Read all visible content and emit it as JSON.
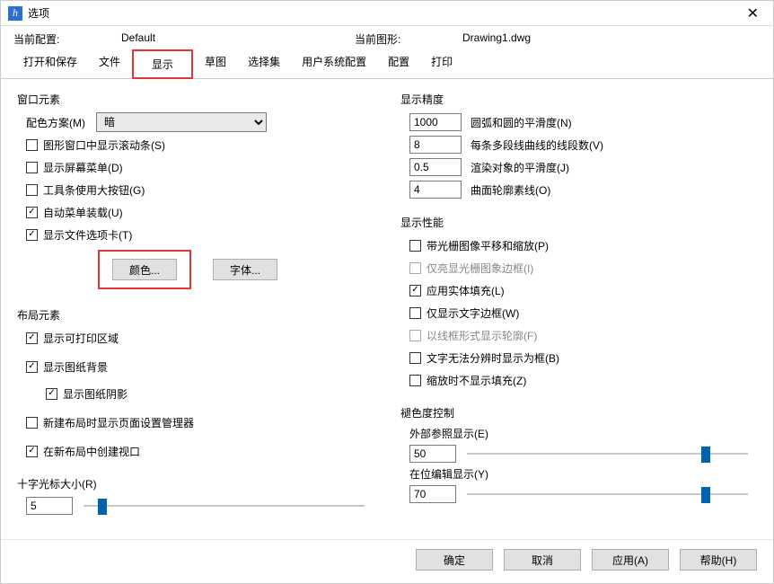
{
  "window": {
    "title": "选项"
  },
  "config": {
    "current_config_label": "当前配置:",
    "current_config_value": "Default",
    "current_drawing_label": "当前图形:",
    "current_drawing_value": "Drawing1.dwg"
  },
  "tabs": {
    "t0": "打开和保存",
    "t1": "文件",
    "t2": "显示",
    "t3": "草图",
    "t4": "选择集",
    "t5": "用户系统配置",
    "t6": "配置",
    "t7": "打印"
  },
  "window_elements": {
    "title": "窗口元素",
    "scheme_label": "配色方案(M)",
    "scheme_value": "暗",
    "show_scroll": "图形窗口中显示滚动条(S)",
    "show_screen_menu": "显示屏幕菜单(D)",
    "large_buttons": "工具条使用大按钮(G)",
    "auto_menu": "自动菜单装载(U)",
    "show_file_tabs": "显示文件选项卡(T)",
    "color_btn": "颜色...",
    "font_btn": "字体..."
  },
  "layout_elements": {
    "title": "布局元素",
    "show_print_area": "显示可打印区域",
    "show_paper_bg": "显示图纸背景",
    "show_paper_shadow": "显示图纸阴影",
    "page_setup_mgr": "新建布局时显示页面设置管理器",
    "create_viewport": "在新布局中创建视口"
  },
  "crosshair": {
    "title": "十字光标大小(R)",
    "value": "5"
  },
  "display_precision": {
    "title": "显示精度",
    "arc_value": "1000",
    "arc_label": "圆弧和圆的平滑度(N)",
    "polyline_value": "8",
    "polyline_label": "每条多段线曲线的线段数(V)",
    "render_value": "0.5",
    "render_label": "渲染对象的平滑度(J)",
    "surface_value": "4",
    "surface_label": "曲面轮廓素线(O)"
  },
  "display_perf": {
    "title": "显示性能",
    "raster_pan": "带光栅图像平移和缩放(P)",
    "raster_frame": "仅亮显光栅图象边框(I)",
    "solid_fill": "应用实体填充(L)",
    "text_frame": "仅显示文字边框(W)",
    "wire_outline": "以线框形式显示轮廓(F)",
    "text_as_box": "文字无法分辨时显示为框(B)",
    "hide_fill_zoom": "缩放时不显示填充(Z)"
  },
  "fade": {
    "title": "褪色度控制",
    "xref_label": "外部参照显示(E)",
    "xref_value": "50",
    "inplace_label": "在位编辑显示(Y)",
    "inplace_value": "70"
  },
  "footer": {
    "ok": "确定",
    "cancel": "取消",
    "apply": "应用(A)",
    "help": "帮助(H)"
  }
}
